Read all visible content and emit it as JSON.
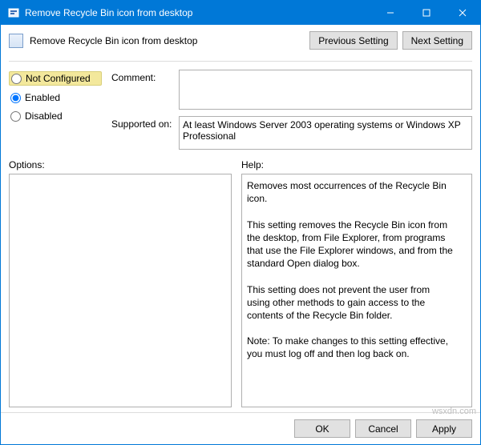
{
  "titlebar": {
    "title": "Remove Recycle Bin icon from desktop"
  },
  "header": {
    "title": "Remove Recycle Bin icon from desktop",
    "prev_label": "Previous Setting",
    "next_label": "Next Setting"
  },
  "radios": {
    "not_configured": "Not Configured",
    "enabled": "Enabled",
    "disabled": "Disabled",
    "selected": "enabled"
  },
  "fields": {
    "comment_label": "Comment:",
    "comment_value": "",
    "supported_label": "Supported on:",
    "supported_value": "At least Windows Server 2003 operating systems or Windows XP Professional"
  },
  "panels": {
    "options_label": "Options:",
    "options_text": "",
    "help_label": "Help:",
    "help_text": "Removes most occurrences of the Recycle Bin icon.\n\nThis setting removes the Recycle Bin icon from the desktop, from File Explorer, from programs that use the File Explorer windows, and from the standard Open dialog box.\n\nThis setting does not prevent the user from using other methods to gain access to the contents of the Recycle Bin folder.\n\nNote: To make changes to this setting effective, you must log off and then log back on."
  },
  "footer": {
    "ok": "OK",
    "cancel": "Cancel",
    "apply": "Apply"
  },
  "watermark": "wsxdn.com"
}
